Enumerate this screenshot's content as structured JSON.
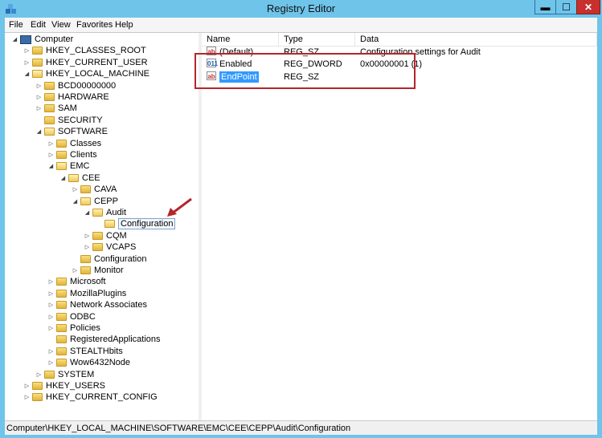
{
  "window": {
    "title": "Registry Editor",
    "minimize": "▬",
    "maximize": "☐",
    "close": "✕"
  },
  "menu": [
    "File",
    "Edit",
    "View",
    "Favorites",
    "Help"
  ],
  "tree": [
    {
      "label": "Computer",
      "icon": "computer-icon",
      "expander": "expanded"
    },
    {
      "label": "HKEY_CLASSES_ROOT",
      "expander": "collapsed"
    },
    {
      "label": "HKEY_CURRENT_USER",
      "expander": "collapsed"
    },
    {
      "label": "HKEY_LOCAL_MACHINE",
      "expander": "expanded"
    },
    {
      "label": "BCD00000000",
      "expander": "collapsed"
    },
    {
      "label": "HARDWARE",
      "expander": "collapsed"
    },
    {
      "label": "SAM",
      "expander": "collapsed"
    },
    {
      "label": "SECURITY",
      "expander": "none"
    },
    {
      "label": "SOFTWARE",
      "expander": "expanded"
    },
    {
      "label": "Classes",
      "expander": "collapsed"
    },
    {
      "label": "Clients",
      "expander": "collapsed"
    },
    {
      "label": "EMC",
      "expander": "expanded"
    },
    {
      "label": "CEE",
      "expander": "expanded"
    },
    {
      "label": "CAVA",
      "expander": "collapsed"
    },
    {
      "label": "CEPP",
      "expander": "expanded"
    },
    {
      "label": "Audit",
      "expander": "expanded"
    },
    {
      "label": "Configuration",
      "expander": "none",
      "selected": true
    },
    {
      "label": "CQM",
      "expander": "collapsed"
    },
    {
      "label": "VCAPS",
      "expander": "collapsed"
    },
    {
      "label": "Configuration",
      "expander": "none"
    },
    {
      "label": "Monitor",
      "expander": "collapsed"
    },
    {
      "label": "Microsoft",
      "expander": "collapsed"
    },
    {
      "label": "MozillaPlugins",
      "expander": "collapsed"
    },
    {
      "label": "Network Associates",
      "expander": "collapsed"
    },
    {
      "label": "ODBC",
      "expander": "collapsed"
    },
    {
      "label": "Policies",
      "expander": "collapsed"
    },
    {
      "label": "RegisteredApplications",
      "expander": "none"
    },
    {
      "label": "STEALTHbits",
      "expander": "collapsed"
    },
    {
      "label": "Wow6432Node",
      "expander": "collapsed"
    },
    {
      "label": "SYSTEM",
      "expander": "collapsed"
    },
    {
      "label": "HKEY_USERS",
      "expander": "collapsed"
    },
    {
      "label": "HKEY_CURRENT_CONFIG",
      "expander": "collapsed"
    }
  ],
  "columns": {
    "name": "Name",
    "type": "Type",
    "data": "Data"
  },
  "values": [
    {
      "icon": "string-value-icon",
      "icon_text": "ab",
      "name": "(Default)",
      "type": "REG_SZ",
      "data": "Configuration settings for Audit"
    },
    {
      "icon": "dword-value-icon",
      "icon_text": "011",
      "name": "Enabled",
      "type": "REG_DWORD",
      "data": "0x00000001 (1)"
    },
    {
      "icon": "string-value-icon",
      "icon_text": "ab",
      "name": "EndPoint",
      "type": "REG_SZ",
      "data": "",
      "selected": true
    }
  ],
  "status": "Computer\\HKEY_LOCAL_MACHINE\\SOFTWARE\\EMC\\CEE\\CEPP\\Audit\\Configuration",
  "colors": {
    "highlight": "#b3262b",
    "selection": "#3399ff",
    "titlebar": "#6fc4ea"
  }
}
